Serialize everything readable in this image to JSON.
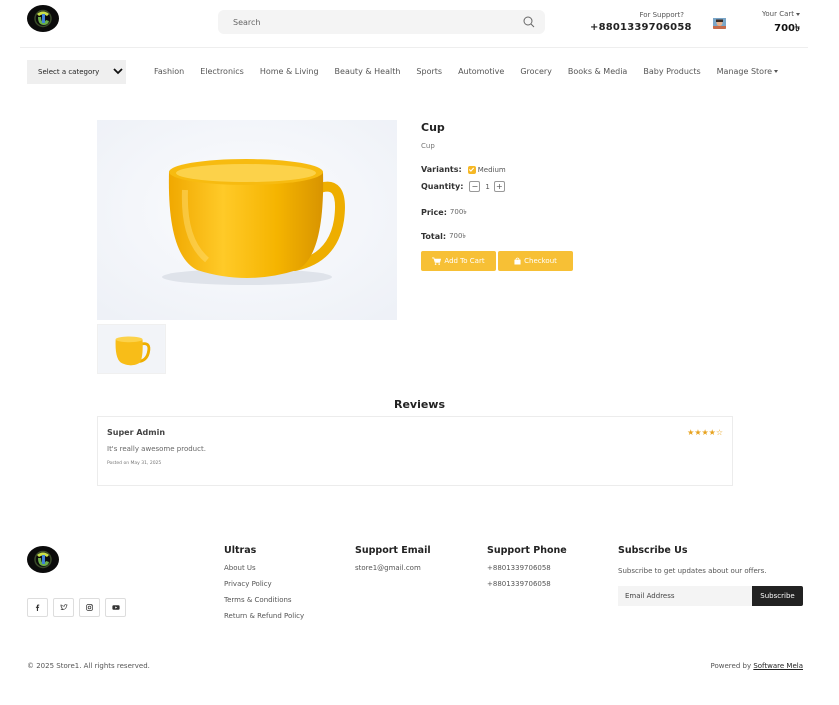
{
  "header": {
    "search_placeholder": "Search",
    "support_label": "For Support?",
    "support_phone": "+8801339706058",
    "cart_label": "Your Cart",
    "cart_total": "700৳"
  },
  "nav": {
    "category_select_label": "Select a category",
    "items": [
      "Fashion",
      "Electronics",
      "Home & Living",
      "Beauty & Health",
      "Sports",
      "Automotive",
      "Grocery",
      "Books & Media",
      "Baby Products"
    ],
    "manage_store": "Manage Store"
  },
  "product": {
    "title": "Cup",
    "subtitle": "Cup",
    "variants_label": "Variants:",
    "variant_value": "Medium",
    "quantity_label": "Quantity:",
    "quantity": "1",
    "qty_minus": "−",
    "qty_plus": "+",
    "price_label": "Price:",
    "price": "700৳",
    "total_label": "Total:",
    "total": "700৳",
    "add_to_cart": "Add To Cart",
    "checkout": "Checkout",
    "accent_color": "#f7c035"
  },
  "reviews": {
    "title": "Reviews",
    "items": [
      {
        "name": "Super Admin",
        "stars": "★★★★☆",
        "text": "It's really awesome product.",
        "date": "Posted on May 31, 2025"
      }
    ]
  },
  "footer": {
    "social_icons": [
      "facebook-icon",
      "twitter-icon",
      "instagram-icon",
      "youtube-icon"
    ],
    "col1_title": "Ultras",
    "col1_links": [
      "About Us",
      "Privacy Policy",
      "Terms & Conditions",
      "Return & Refund Policy"
    ],
    "col2_title": "Support Email",
    "col2_email": "store1@gmail.com",
    "col3_title": "Support Phone",
    "col3_phones": [
      "+8801339706058",
      "+8801339706058"
    ],
    "col4_title": "Subscribe Us",
    "col4_desc": "Subscribe to get updates about our offers.",
    "email_placeholder": "Email Address",
    "subscribe_button": "Subscribe",
    "copyright": "© 2025 Store1. All rights reserved.",
    "powered_by": "Powered by",
    "powered_link": "Software Mela"
  }
}
